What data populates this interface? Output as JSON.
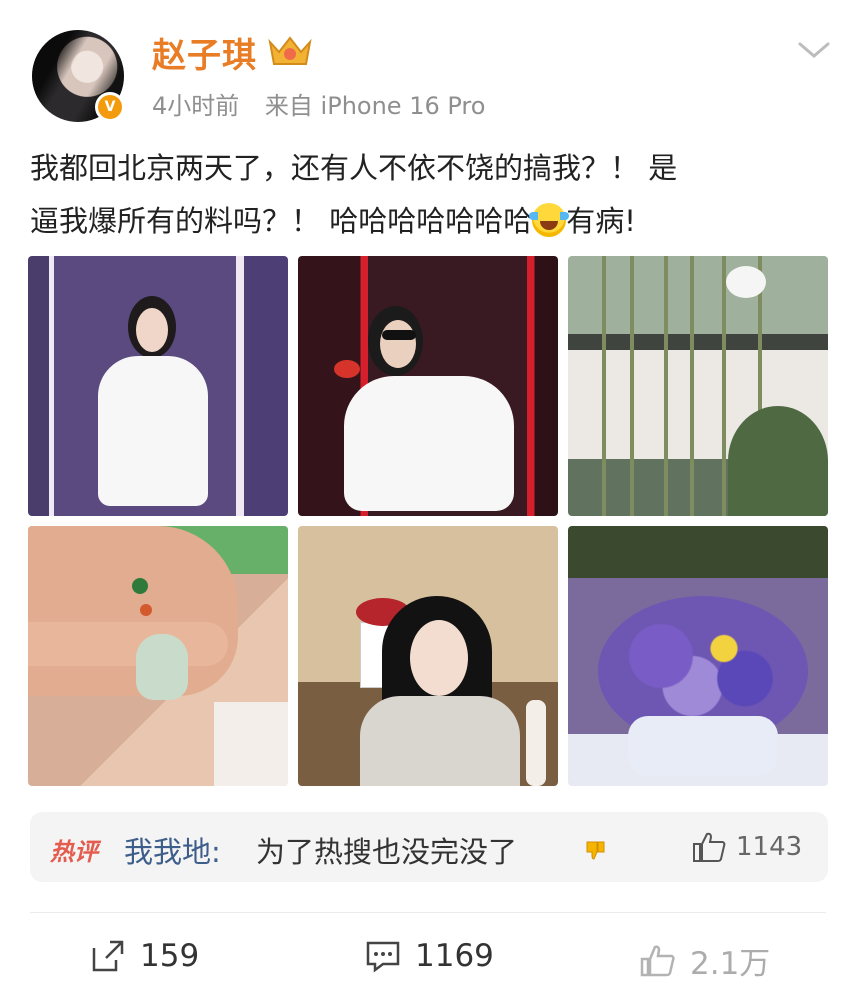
{
  "post": {
    "author": "赵子琪",
    "time": "4小时前",
    "source": "来自 iPhone 16 Pro",
    "text_line1": "我都回北京两天了，还有人不依不饶的搞我？！ 是",
    "text_line2_a": "逼我爆所有的料吗？！ 哈哈哈哈哈哈哈",
    "text_line2_b": "有病!",
    "emoji": "laughing-tears-emoji"
  },
  "images": [
    "stage-performance-white-dress",
    "stage-performance-sunglasses",
    "bamboo-courtyard",
    "jade-pendant-in-hand",
    "woman-portrait-with-flowers",
    "purple-flower-bouquet"
  ],
  "hot_comment": {
    "label": "热评",
    "user": "我我地",
    "text": "为了热搜也没完没了",
    "likes": "1143"
  },
  "actions": {
    "share_count": "159",
    "comment_count": "1169",
    "like_count": "2.1万"
  },
  "colors": {
    "name_orange": "#e87d25",
    "verify_badge": "#f39b0c",
    "hot_label_red": "#e45c4e",
    "comment_user_blue": "#3d5e8a",
    "meta_gray": "#8f8f8f"
  }
}
